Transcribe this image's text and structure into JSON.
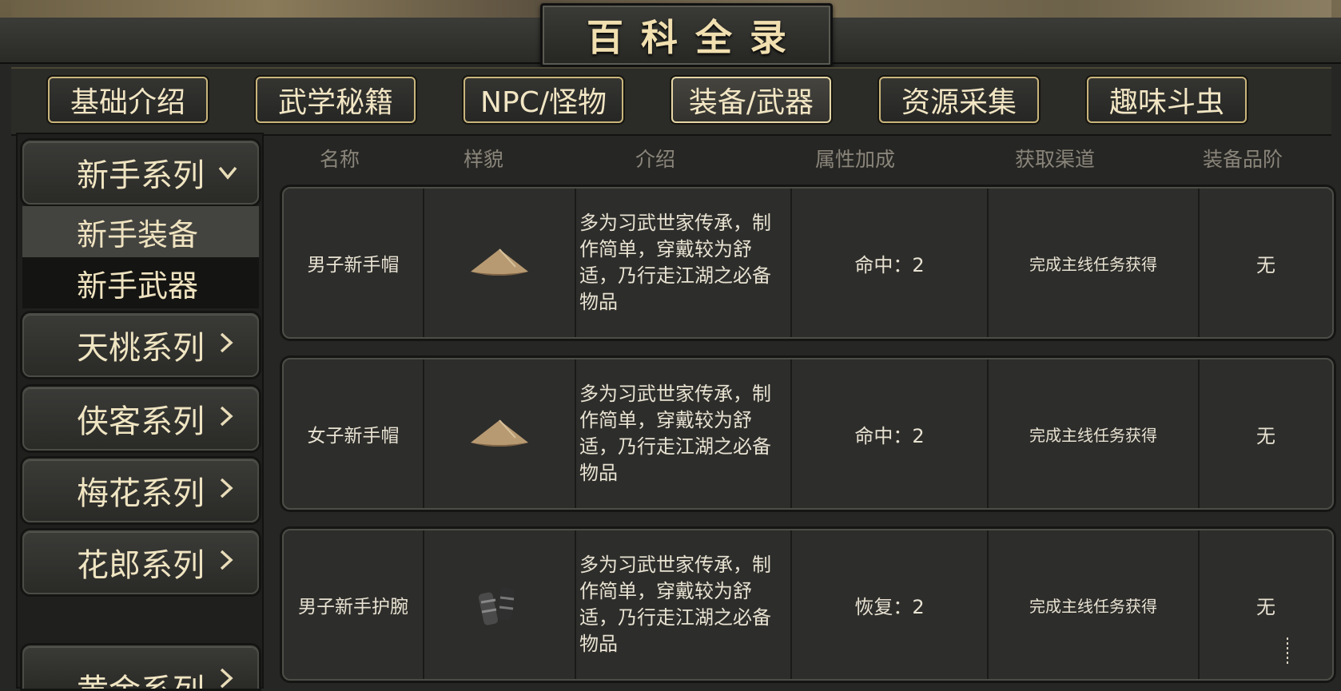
{
  "title": "百科全录",
  "tabs": [
    {
      "label": "基础介绍",
      "active": false
    },
    {
      "label": "武学秘籍",
      "active": false
    },
    {
      "label": "NPC/怪物",
      "active": false
    },
    {
      "label": "装备/武器",
      "active": true
    },
    {
      "label": "资源采集",
      "active": false
    },
    {
      "label": "趣味斗虫",
      "active": false
    }
  ],
  "sidebar": {
    "categories": [
      {
        "label": "新手系列",
        "chevron": "chevron-down",
        "expanded": true
      },
      {
        "label": "天桃系列",
        "chevron": "chevron-right"
      },
      {
        "label": "侠客系列",
        "chevron": "chevron-right"
      },
      {
        "label": "梅花系列",
        "chevron": "chevron-right"
      },
      {
        "label": "花郎系列",
        "chevron": "chevron-right"
      },
      {
        "label": "黄金系列",
        "chevron": "chevron-right"
      }
    ],
    "sub_items": [
      {
        "label": "新手装备",
        "selected": true
      },
      {
        "label": "新手武器",
        "selected": false
      }
    ]
  },
  "table": {
    "headers": [
      "名称",
      "样貌",
      "介绍",
      "属性加成",
      "获取渠道",
      "装备品阶"
    ],
    "rows": [
      {
        "name": "男子新手帽",
        "icon": "straw-hat-icon",
        "desc": "多为习武世家传承，制作简单，穿戴较为舒适，乃行走江湖之必备物品",
        "attr": "命中：2",
        "source": "完成主线任务获得",
        "grade": "无"
      },
      {
        "name": "女子新手帽",
        "icon": "straw-hat-icon",
        "desc": "多为习武世家传承，制作简单，穿戴较为舒适，乃行走江湖之必备物品",
        "attr": "命中：2",
        "source": "完成主线任务获得",
        "grade": "无"
      },
      {
        "name": "男子新手护腕",
        "icon": "wrist-guard-icon",
        "desc": "多为习武世家传承，制作简单，穿戴较为舒适，乃行走江湖之必备物品",
        "attr": "恢复：2",
        "source": "完成主线任务获得",
        "grade": "无"
      }
    ]
  },
  "colors": {
    "accent_gold": "#c9b57c",
    "panel": "#2d2d2b",
    "text": "#e8e2d2"
  }
}
